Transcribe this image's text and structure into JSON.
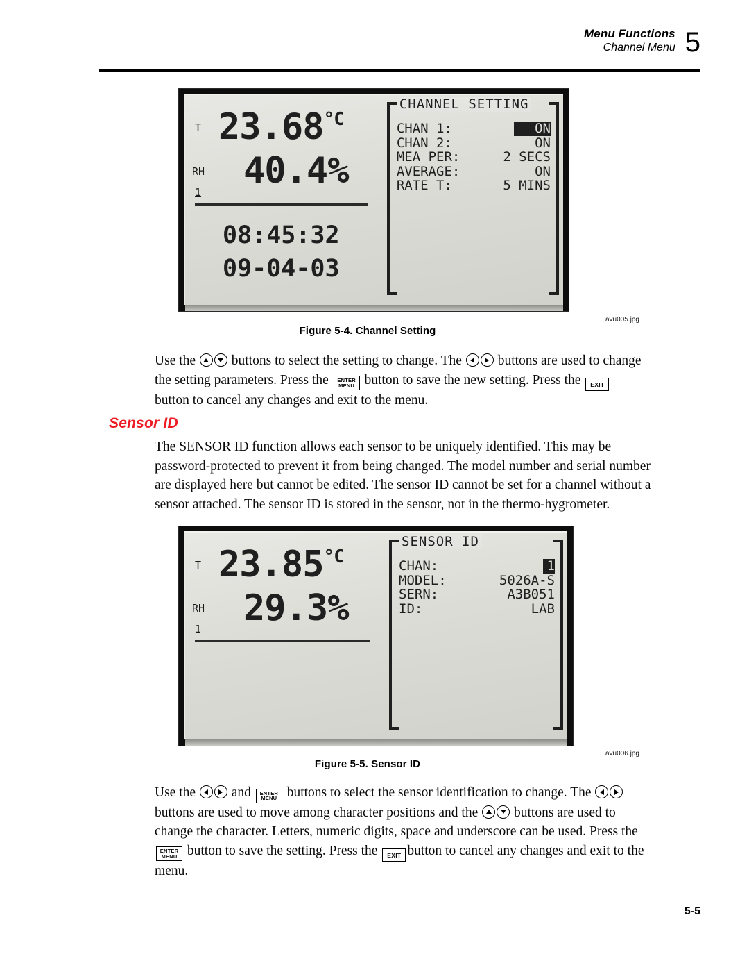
{
  "header": {
    "line1": "Menu Functions",
    "line2": "Channel Menu",
    "chapter": "5"
  },
  "figure1": {
    "caption": "Figure 5-4. Channel Setting",
    "filename": "avu005.jpg",
    "display": {
      "t_label": "T",
      "rh_label": "RH",
      "chan_label": "1",
      "temperature": "23.68",
      "temperature_unit": "°C",
      "humidity": "40.4",
      "humidity_unit": "%",
      "time": "08:45:32",
      "date": "09-04-03",
      "menu_title": "CHANNEL SETTING",
      "rows": [
        {
          "label": "CHAN 1:",
          "value": "ON",
          "highlighted": true
        },
        {
          "label": "CHAN 2:",
          "value": "ON",
          "highlighted": false
        },
        {
          "label": "MEA PER:",
          "value": "2 SECS",
          "highlighted": false
        },
        {
          "label": "AVERAGE:",
          "value": "ON",
          "highlighted": false
        },
        {
          "label": "RATE T:",
          "value": "5 MINS",
          "highlighted": false
        }
      ]
    }
  },
  "figure2": {
    "caption": "Figure 5-5. Sensor ID",
    "filename": "avu006.jpg",
    "display": {
      "t_label": "T",
      "rh_label": "RH",
      "chan_label": "1",
      "temperature": "23.85",
      "temperature_unit": "°C",
      "humidity": "29.3",
      "humidity_unit": "%",
      "menu_title": "SENSOR ID",
      "rows": [
        {
          "label": "CHAN:",
          "value": "1",
          "highlighted": true
        },
        {
          "label": "MODEL:",
          "value": "5026A-S",
          "highlighted": false
        },
        {
          "label": "SERN:",
          "value": "A3B051",
          "highlighted": false
        },
        {
          "label": "ID:",
          "value": "LAB",
          "highlighted": false
        }
      ]
    }
  },
  "paragraphs": {
    "channel_setting": {
      "p1": "Use the ",
      "p2": " buttons to select the setting to change. The ",
      "p3": " buttons are used to change the setting parameters. Press the ",
      "p4": " button to save the new setting. Press the ",
      "p5": " button to cancel any changes and exit to the menu."
    },
    "sensor_id_intro": "The SENSOR ID function allows each sensor to be uniquely identified. This may be password-protected to prevent it from being changed. The model number and serial number are displayed here but cannot be edited. The sensor ID cannot be set for a channel without a sensor attached. The sensor ID is stored in the sensor, not in the thermo-hygrometer.",
    "sensor_id_usage": {
      "p1": "Use the ",
      "p2": " and ",
      "p3": " buttons to select the sensor identification to change. The ",
      "p4": " buttons are used to move among character positions and the ",
      "p5": " buttons are used to change the character. Letters, numeric digits, space and underscore can be used. Press the ",
      "p6": " button to save the setting. Press the ",
      "p7": "button to cancel any changes and exit to the menu."
    }
  },
  "section_heading": "Sensor ID",
  "keys": {
    "enter_line1": "ENTER",
    "enter_line2": "MENU",
    "exit": "EXIT"
  },
  "footer": {
    "page_number": "5-5"
  },
  "colors": {
    "heading_red": "#ed1c24",
    "lcd_screen": "#e0e0dc",
    "lcd_bezel": "#0d0d0d"
  }
}
